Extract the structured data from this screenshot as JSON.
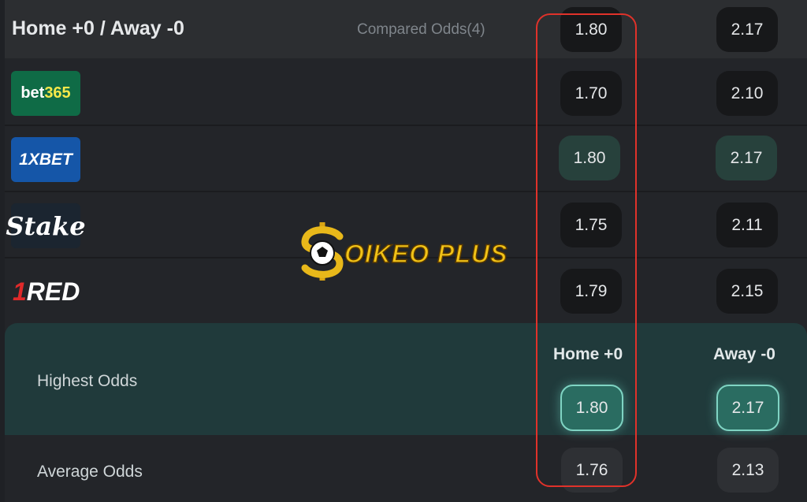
{
  "header": {
    "title": "Home +0 / Away -0",
    "compared": "Compared Odds(4)"
  },
  "header_odds": {
    "home": "1.80",
    "away": "2.17"
  },
  "bookmakers": [
    {
      "name": "bet365",
      "logo_main": "bet",
      "logo_accent": "365",
      "home": "1.70",
      "away": "2.10",
      "highlighted": false
    },
    {
      "name": "1XBET",
      "logo_main": "1XBET",
      "home": "1.80",
      "away": "2.17",
      "highlighted": true
    },
    {
      "name": "Stake",
      "logo_main": "Stake",
      "home": "1.75",
      "away": "2.11",
      "highlighted": false
    },
    {
      "name": "1RED",
      "logo_accent": "1",
      "logo_main": "RED",
      "home": "1.79",
      "away": "2.15",
      "highlighted": false
    }
  ],
  "summary": {
    "highest_label": "Highest Odds",
    "home_header": "Home +0",
    "away_header": "Away -0",
    "highest_home": "1.80",
    "highest_away": "2.17",
    "average_label": "Average Odds",
    "average_home": "1.76",
    "average_away": "2.13"
  },
  "watermark": {
    "text": "OIKEO PLUS",
    "icon": "soccer-ball-dollar-icon"
  },
  "colors": {
    "background": "#1f2125",
    "highlight_box": "#e0322a",
    "best_odds": "#2a6c61",
    "watermark": "#f2c317"
  }
}
